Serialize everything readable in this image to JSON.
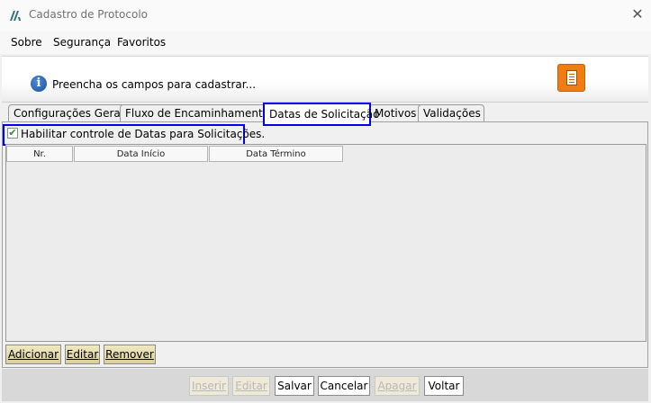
{
  "window": {
    "title": "Cadastro de Protocolo",
    "close_glyph": "✕"
  },
  "menu": {
    "items": [
      {
        "label": "Sobre",
        "mnemonic": "o"
      },
      {
        "label": "Segurança",
        "mnemonic": ""
      },
      {
        "label": "Favoritos",
        "mnemonic": ""
      }
    ]
  },
  "banner": {
    "info_icon": "info-icon",
    "info_glyph": "i",
    "message": "Preencha os campos para cadastrar...",
    "action_icon": "document-icon",
    "action_color": "#f07c14"
  },
  "tabs": [
    {
      "label": "Configurações Gerais",
      "active": false
    },
    {
      "label": "Fluxo de Encaminhamentos",
      "active": false
    },
    {
      "label": "Datas de Solicitação",
      "active": true
    },
    {
      "label": "Motivos",
      "active": false
    },
    {
      "label": "Validações",
      "active": false
    }
  ],
  "panel": {
    "checkbox_label": "Habilitar controle de Datas para Solicitações.",
    "checkbox_checked": true,
    "checkbox_mark": "✔",
    "grid_columns": [
      "Nr.",
      "Data Início",
      "Data Término"
    ],
    "buttons": [
      "Adicionar",
      "Editar",
      "Remover"
    ]
  },
  "footer": {
    "buttons": [
      {
        "label": "Inserir",
        "enabled": false
      },
      {
        "label": "Editar",
        "enabled": false
      },
      {
        "label": "Salvar",
        "enabled": true
      },
      {
        "label": "Cancelar",
        "enabled": true
      },
      {
        "label": "Apagar",
        "enabled": false
      },
      {
        "label": "Voltar",
        "enabled": true
      }
    ]
  },
  "colors": {
    "highlight": "#0000ee",
    "button_tan": "#dcd098"
  }
}
